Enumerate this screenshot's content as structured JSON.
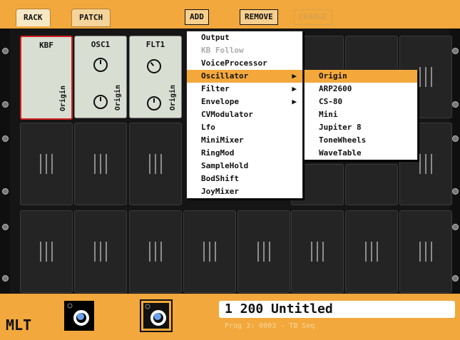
{
  "tabs": [
    "RACK",
    "PATCH"
  ],
  "toolbar": {
    "add": "ADD",
    "remove": "REMOVE",
    "change": "CHANGE"
  },
  "modules": [
    {
      "title": "KBF",
      "label": "Origin"
    },
    {
      "title": "OSC1",
      "label": "Origin"
    },
    {
      "title": "FLT1",
      "label": "Origin"
    }
  ],
  "add_menu": [
    {
      "label": "Output",
      "disabled": false,
      "submenu": false
    },
    {
      "label": "KB Follow",
      "disabled": true,
      "submenu": false
    },
    {
      "label": "VoiceProcessor",
      "disabled": false,
      "submenu": false
    },
    {
      "label": "Oscillator",
      "disabled": false,
      "submenu": true,
      "highlighted": true
    },
    {
      "label": "Filter",
      "disabled": false,
      "submenu": true
    },
    {
      "label": "Envelope",
      "disabled": false,
      "submenu": true
    },
    {
      "label": "CVModulator",
      "disabled": false,
      "submenu": false
    },
    {
      "label": "Lfo",
      "disabled": false,
      "submenu": false
    },
    {
      "label": "MiniMixer",
      "disabled": false,
      "submenu": false
    },
    {
      "label": "RingMod",
      "disabled": false,
      "submenu": false
    },
    {
      "label": "SampleHold",
      "disabled": false,
      "submenu": false
    },
    {
      "label": "BodShift",
      "disabled": false,
      "submenu": false
    },
    {
      "label": "JoyMixer",
      "disabled": false,
      "submenu": false
    }
  ],
  "oscillator_submenu": [
    {
      "label": "Origin",
      "highlighted": true
    },
    {
      "label": "ARP2600"
    },
    {
      "label": "CS-80"
    },
    {
      "label": "Mini"
    },
    {
      "label": "Jupiter 8"
    },
    {
      "label": "ToneWheels"
    },
    {
      "label": "WaveTable"
    }
  ],
  "bottom": {
    "logo": "MLT",
    "program_name": "1 200 Untitled",
    "program_sub": "Prog 3: 0003 - TB Seq"
  }
}
